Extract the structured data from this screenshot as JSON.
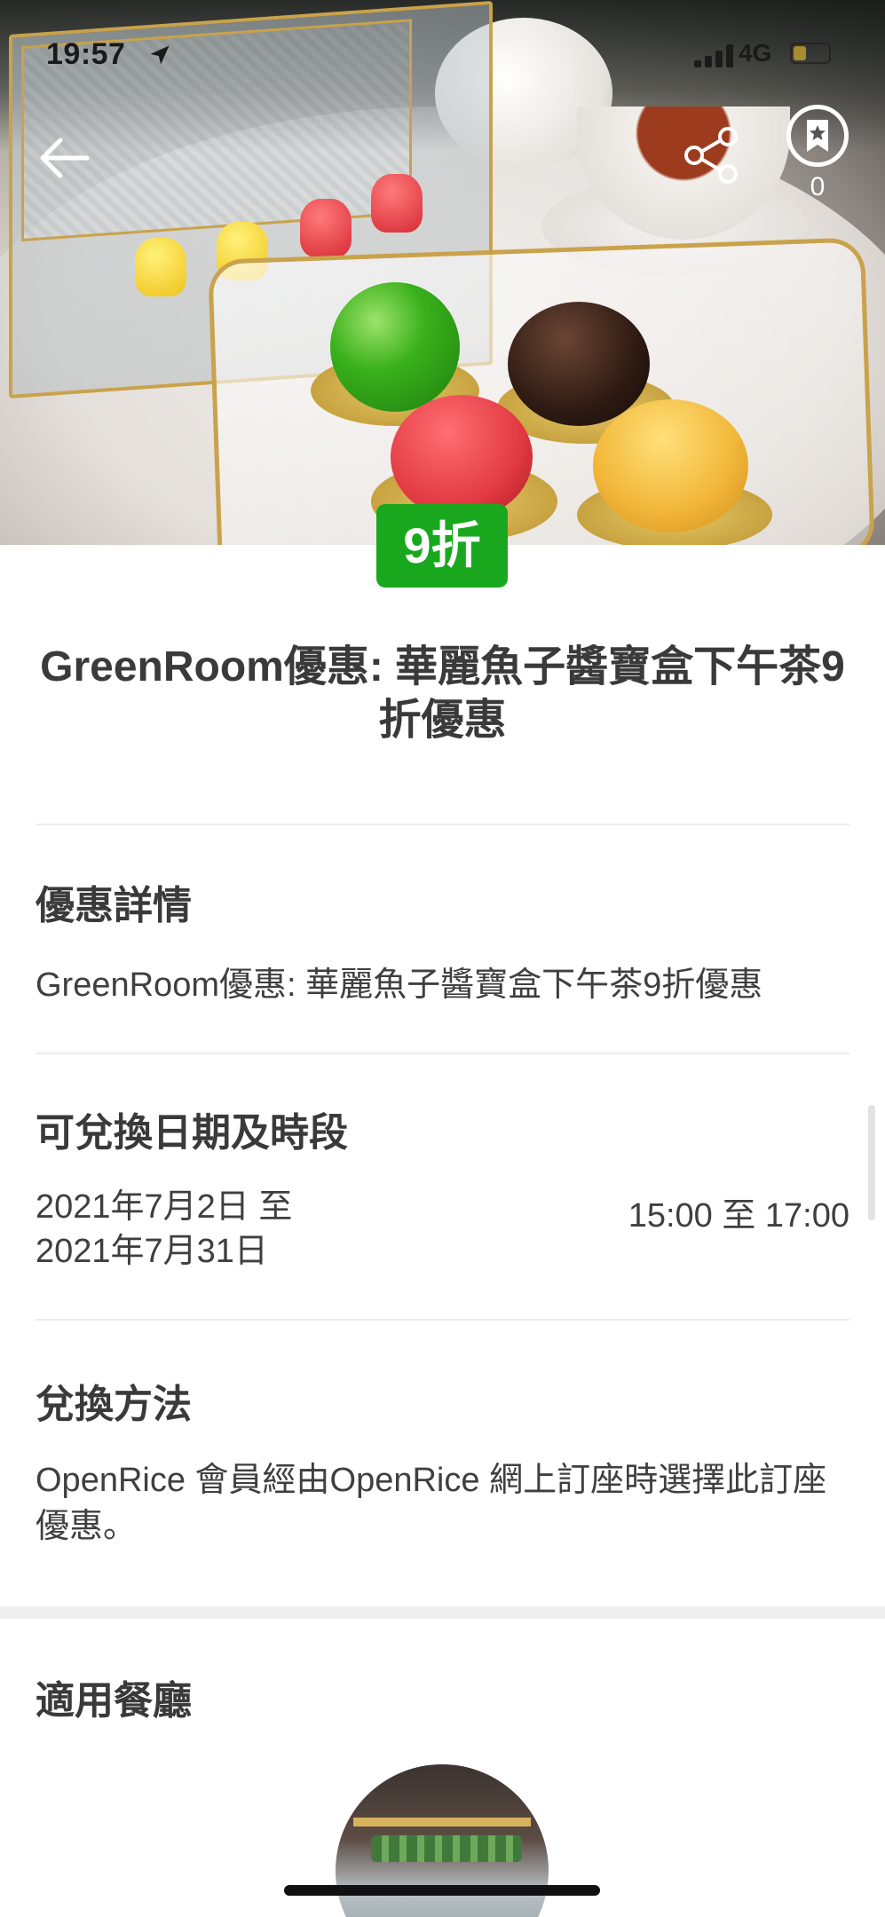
{
  "status_bar": {
    "time": "19:57",
    "network": "4G"
  },
  "header": {
    "bookmark_count": "0"
  },
  "offer": {
    "discount_badge": "9折",
    "title": "GreenRoom優惠: 華麗魚子醬寶盒下午茶9折優惠"
  },
  "details": {
    "heading": "優惠詳情",
    "text": "GreenRoom優惠: 華麗魚子醬寶盒下午茶9折優惠"
  },
  "redeem_period": {
    "heading": "可兌換日期及時段",
    "date_from": "2021年7月2日 至",
    "date_to": "2021年7月31日",
    "time_range": "15:00 至 17:00"
  },
  "redeem_method": {
    "heading": "兌換方法",
    "text": "OpenRice 會員經由OpenRice 網上訂座時選擇此訂座優惠。"
  },
  "restaurants": {
    "heading": "適用餐廳"
  },
  "colors": {
    "badge_green": "#19a81d",
    "text_dark": "#3a3a3a",
    "divider": "#ececec"
  },
  "icons": {
    "back": "arrow-left-icon",
    "share": "share-icon",
    "bookmark": "bookmark-icon"
  }
}
